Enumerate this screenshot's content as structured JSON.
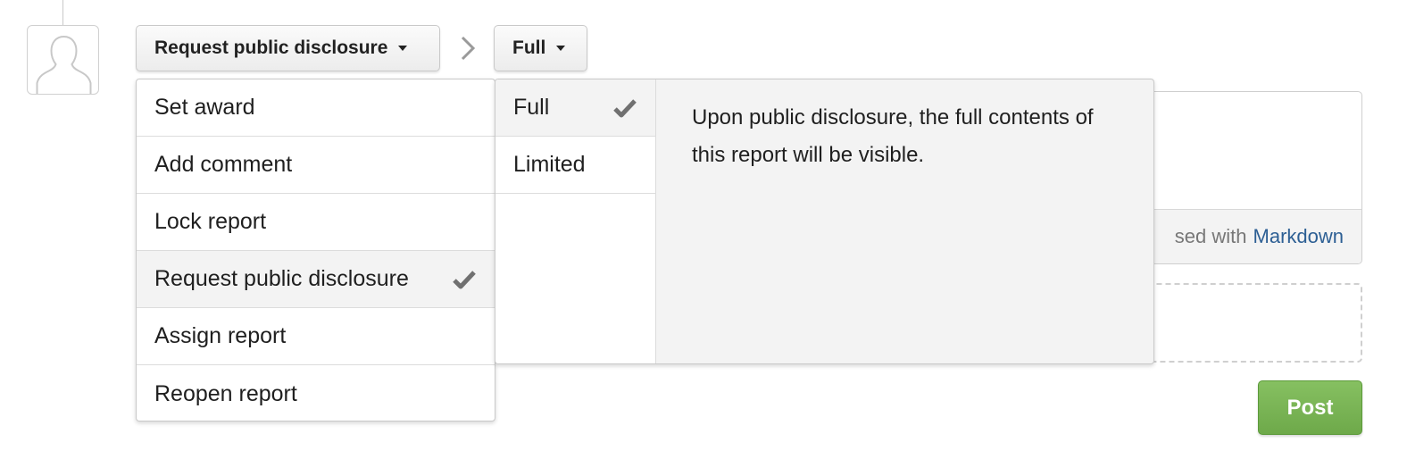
{
  "toolbar": {
    "action_label": "Request public disclosure",
    "scope_label": "Full"
  },
  "action_menu": {
    "items": [
      {
        "label": "Set award",
        "selected": false
      },
      {
        "label": "Add comment",
        "selected": false
      },
      {
        "label": "Lock report",
        "selected": false
      },
      {
        "label": "Request public disclosure",
        "selected": true
      },
      {
        "label": "Assign report",
        "selected": false
      },
      {
        "label": "Reopen report",
        "selected": false
      }
    ]
  },
  "scope_menu": {
    "items": [
      {
        "label": "Full",
        "selected": true
      },
      {
        "label": "Limited",
        "selected": false
      }
    ],
    "description": "Upon public disclosure, the full contents of this report will be visible."
  },
  "editor": {
    "footer_text": "sed with",
    "footer_link": "Markdown"
  },
  "post_label": "Post",
  "colors": {
    "post_green": "#76b552",
    "link_blue": "#2d5f94",
    "selected_bg": "#f3f3f3"
  },
  "icons": {
    "avatar": "user-silhouette-icon",
    "separator": "chevron-right-icon",
    "selected": "checkmark-icon",
    "dropdown": "caret-down-icon"
  }
}
